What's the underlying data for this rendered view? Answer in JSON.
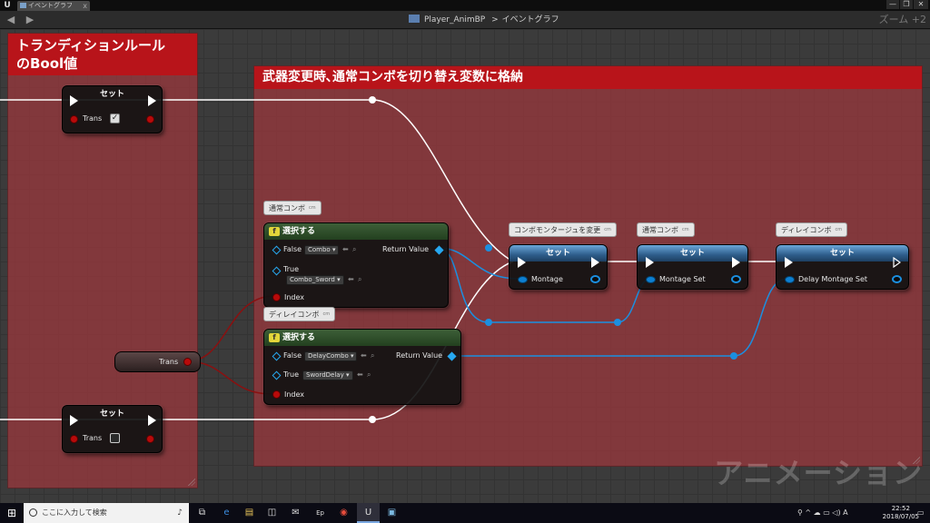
{
  "titlebar": {
    "logo": "U",
    "tab_label": "イベントグラフ",
    "tab_close": "x",
    "minimize": "—",
    "maximize": "❐",
    "close": "✕"
  },
  "toolbar": {
    "back": "◀",
    "forward": "▶",
    "blueprint_name": "Player_AnimBP",
    "separator": ">",
    "graph_name": "イベントグラフ",
    "zoom": "ズーム +2"
  },
  "comments": {
    "bool_values": "トランディションルール\nのBool値",
    "main": "武器変更時､通常コンボを切り替え変数に格納",
    "watermark": "アニメーション"
  },
  "nodes": {
    "set_trans_top": {
      "title": "セット",
      "pin_label": "Trans",
      "checked": "✓"
    },
    "set_trans_bottom": {
      "title": "セット",
      "pin_label": "Trans"
    },
    "trans_getter": {
      "label": "Trans"
    },
    "select_combo": {
      "bubble": "通常コンボ",
      "title": "選択する",
      "false_label": "False",
      "false_value": "Combo",
      "true_label": "True",
      "true_value": "Combo_Sword",
      "index_label": "Index",
      "return_label": "Return Value"
    },
    "select_delay": {
      "bubble": "ディレイコンボ",
      "title": "選択する",
      "false_label": "False",
      "false_value": "DelayCombo",
      "true_label": "True",
      "true_value": "SwordDelay",
      "index_label": "Index",
      "return_label": "Return Value"
    },
    "set_montage": {
      "bubble": "コンボモンタージュを変更",
      "title": "セット",
      "pin_label": "Montage"
    },
    "set_montage_set": {
      "bubble": "通常コンボ",
      "title": "セット",
      "pin_label": "Montage Set"
    },
    "set_delay_montage": {
      "bubble": "ディレイコンボ",
      "title": "セット",
      "pin_label": "Delay Montage Set"
    }
  },
  "icons": {
    "function": "f",
    "dropdown_arrow": "▾",
    "reset_arrow": "⬅",
    "search": "⌕",
    "bubble_tag": "cm"
  },
  "taskbar": {
    "start": "⊞",
    "search_placeholder": "ここに入力して検索",
    "mic": "♪",
    "apps": [
      "⧉",
      "e",
      "▤",
      "◫",
      "✉",
      "Ep",
      "◉",
      "U",
      "▣"
    ],
    "tray": "⚲  ^ ☁ ▭ ◁) A",
    "time": "22:52",
    "date": "2018/07/05",
    "notify": "▭"
  },
  "colors": {
    "comment_header": "#b8141a",
    "comment_body": "#963c3c",
    "exec_wire": "#ffffff",
    "object_wire": "#1b8fe0",
    "bool_wire": "#8a1010"
  }
}
